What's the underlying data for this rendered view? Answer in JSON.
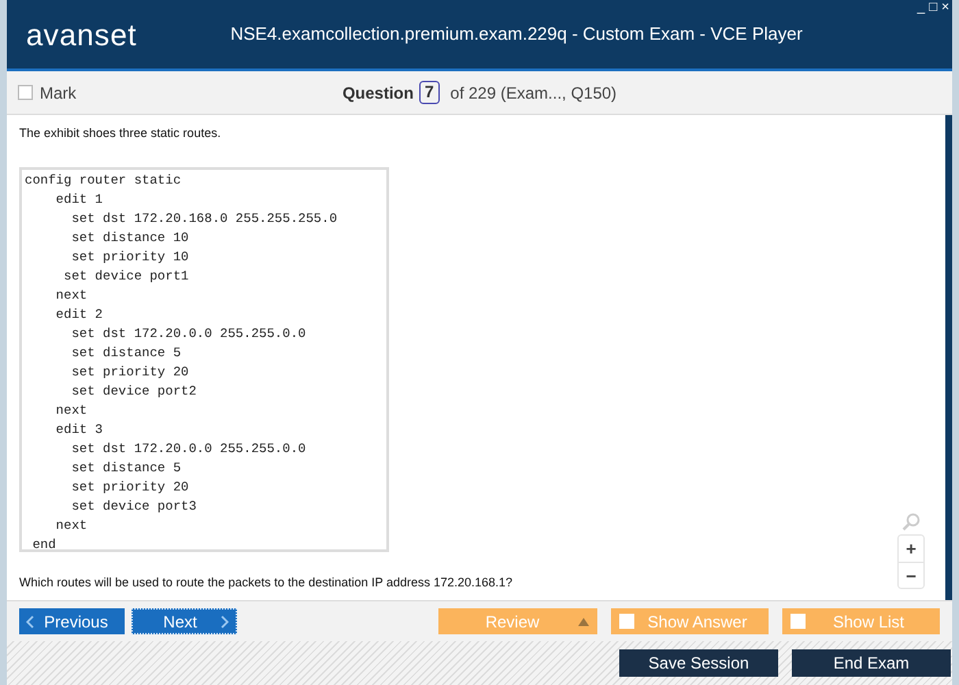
{
  "window": {
    "logo": "avanset",
    "title": "NSE4.examcollection.premium.exam.229q - Custom Exam - VCE Player",
    "controls": [
      "_",
      "□",
      "×"
    ]
  },
  "toolbar": {
    "mark": {
      "label": "Mark",
      "checked": false
    },
    "question_label": "Question",
    "question_number": "7",
    "question_suffix": "of 229 (Exam..., Q150)"
  },
  "content": {
    "intro": "The exhibit shoes three static routes.",
    "exhibit_lines": [
      "config router static",
      "    edit 1",
      "      set dst 172.20.168.0 255.255.255.0",
      "      set distance 10",
      "      set priority 10",
      "     set device port1",
      "    next",
      "    edit 2",
      "      set dst 172.20.0.0 255.255.0.0",
      "      set distance 5",
      "      set priority 20",
      "      set device port2",
      "    next",
      "    edit 3",
      "      set dst 172.20.0.0 255.255.0.0",
      "      set distance 5",
      "      set priority 20",
      "      set device port3",
      "    next",
      " end"
    ],
    "question": "Which routes will be used to route the packets to the destination IP address 172.20.168.1?",
    "zoom": [
      "+",
      "−"
    ]
  },
  "nav": {
    "previous": "Previous",
    "next": "Next",
    "review": "Review",
    "show_answer": {
      "label": "Show Answer",
      "checked": false
    },
    "show_list": {
      "label": "Show List",
      "checked": false
    }
  },
  "footer": {
    "buttons": [
      "Save Session",
      "End Exam"
    ]
  }
}
